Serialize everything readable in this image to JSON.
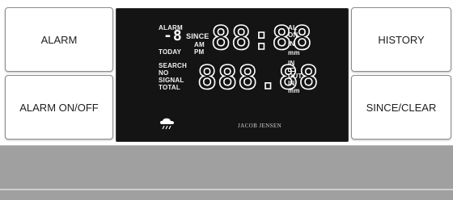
{
  "buttons": {
    "alarm": "ALARM",
    "alarm_on_off": "ALARM ON/OFF",
    "history": "HISTORY",
    "since_clear": "SINCE/CLEAR"
  },
  "display": {
    "top_row": {
      "label_alarm": "ALARM",
      "minus_digit": "-8",
      "label_since": "SINCE",
      "label_today": "TODAY",
      "label_am": "AM",
      "label_pm": "PM",
      "digits": "88:88",
      "label_al": "AL",
      "label_on": "ON",
      "label_in": "IN",
      "label_mm": "mm"
    },
    "bottom_row": {
      "label_search": "SEARCH",
      "label_no": "NO",
      "label_signal": "SIGNAL",
      "label_total": "TOTAL",
      "digits": "888.88",
      "label_in": "IN",
      "label_out": "OUT",
      "label_in2": "IN",
      "label_mm": "mm"
    },
    "icon": "rain-cloud-icon",
    "brand": "JACOB JENSEN"
  },
  "colors": {
    "lcd_background": "#141414",
    "segment": "#ffffff",
    "bar": "#a0a0a0"
  }
}
